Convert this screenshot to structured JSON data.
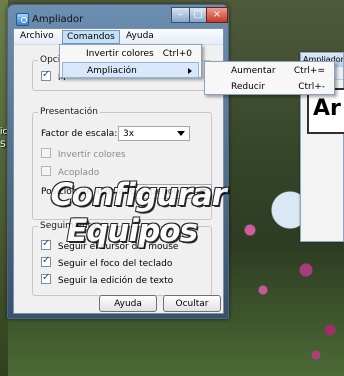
{
  "desktop": {
    "left_labels": [
      "ic",
      "S"
    ],
    "background_window": {
      "title": "Ampliador",
      "large_text": "Ar"
    }
  },
  "window": {
    "title": "Ampliador",
    "menus": [
      "Archivo",
      "Comandos",
      "Ayuda"
    ],
    "options_group": {
      "title": "Opcio",
      "checkbox_label": "M",
      "checked": true
    },
    "presentation": {
      "title": "Presentación",
      "scale_label": "Factor de escala:",
      "scale_value": "3x",
      "invert_label": "Invertir colores",
      "invert_checked": false,
      "docked_label": "Acoplado",
      "docked_checked": false,
      "dock_position_label": "Posición de acoplado:",
      "dock_position_value": "Superior"
    },
    "tracking": {
      "title": "Seguimiento",
      "items": [
        {
          "label": "Seguir el cursor del mouse",
          "checked": true
        },
        {
          "label": "Seguir el foco del teclado",
          "checked": true
        },
        {
          "label": "Seguir la edición de texto",
          "checked": true
        }
      ]
    },
    "buttons": {
      "help": "Ayuda",
      "hide": "Ocultar"
    }
  },
  "commands_menu": {
    "items": [
      {
        "label": "Invertir colores",
        "shortcut": "Ctrl+0"
      },
      {
        "label": "Ampliación",
        "shortcut": ""
      }
    ]
  },
  "zoom_submenu": {
    "items": [
      {
        "label": "Aumentar",
        "shortcut": "Ctrl+="
      },
      {
        "label": "Reducir",
        "shortcut": "Ctrl+-"
      }
    ]
  },
  "watermark": "Configurar Equipos",
  "icons": [
    "magnifier-app-icon",
    "minimize-icon",
    "maximize-icon",
    "close-icon",
    "check-icon",
    "dropdown-arrow-icon",
    "submenu-arrow-icon"
  ]
}
